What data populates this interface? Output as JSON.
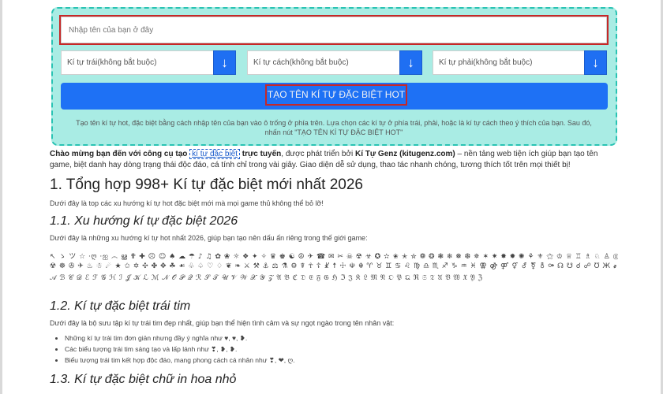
{
  "form": {
    "name_placeholder": "Nhập tên của bạn ở đây",
    "select_left": "Kí tự trái(không bắt buộc)",
    "select_middle": "Kí tự cách(không bắt buộc)",
    "select_right": "Kí tự phải(không bắt buộc)",
    "arrow_glyph": "↓",
    "generate_label": "TẠO TÊN KÍ TỰ ĐẶC BIỆT HOT",
    "hint": "Tạo tên kí tự hot, đặc biệt bằng cách nhập tên của bạn vào ô trống ở phía trên. Lựa chọn các kí tự ở phía trái, phải, hoặc là kí tự cách theo ý thích của bạn. Sau đó, nhấn nút \"TẠO TÊN KÍ TỰ ĐẶC BIỆT HOT\""
  },
  "intro": {
    "lead_bold": "Chào mừng bạn đến với công cụ tạo",
    "link": "kí tự đặc biệt",
    "bold_after_link": "trực tuyến",
    "text_1": ", được phát triển bởi",
    "brand": "Kí Tự Genz (kitugenz.com)",
    "text_2": "– nền tảng web tiện ích giúp bạn tạo tên game, biệt danh hay dòng trạng thái độc đáo, cá tính chỉ trong vài giây. Giao diện dễ sử dụng, thao tác nhanh chóng, tương thích tốt trên mọi thiết bị!"
  },
  "section1": {
    "title": "1. Tổng hợp 998+ Kí tự đặc biệt mới nhất 2026",
    "desc": "Dưới đây là top các xu hướng kí tự hot đặc biệt mới mà mọi game thủ không thể bỏ lỡ!"
  },
  "section1_1": {
    "title": "1.1. Xu hướng kí tự đặc biệt 2026",
    "desc": "Dưới đây là những xu hướng kí tự hot nhất 2026, giúp bạn tạo nên dấu ấn riêng trong thế giới game:",
    "symbols_line1": "↖ ゝ ツ ☆ ·ღ ·ஐ ෴ ൠ ✟ ✚ ☹ ☺ ♠ ☁ ☂ ♪ ♫ ✿ ❀ ☼ ❖ ✦ ✧ ♛ ♚ ☯ ☮ ✈ ☎ ✉ ✂ ☠ ☢ ☣ ✪ ✫ ✬ ✭ ✮ ❁ ❂ ❃ ❄ ❅ ❆ ✵ ✶ ✷ ✸ ✹ ✺ ⚘ ⚜ ⚝ ♔ ♕ ♖ ♗ ♘ ♙ ◎ ◉ ◈ ◇ ◆ ▣ ▤ ▥ ▦ ▧ ▨ ⊙ ⊚ ⊛ ∞ ∂ ℓ ℘",
    "symbols_line2": "☢ ☸ ✇ ✈ ♨ ☃ ☄ ★ ✩ ✡ ✣ ✤ ✥ ☘ ☙ ♧ ♤ ♡ ♢ ❦ ❧ ⚔ ⚒ ⚓ ⚖ ⚗ ⚙ ☤ ☥ ☦ ☧ ☨ ☩ ☫ ☬ ♈ ♉ ♊ ♋ ♌ ♍ ♎ ♏ ♐ ♑ ♒ ♓ ⚢ ⚣ ⚤ ⚥ ⚦ ⚧ ⚨ ⚩ ☊ ☋ ☌ ☍ Ʊ Ӂ ҂ Ԇ ԇ Ɯ Ǣ Ʀ Ȿ ɮ ʘ ʭ Æ Ɐ Ǽ",
    "symbols_line3": "𝒜 ℬ 𝒞 𝒟 ℰ ℱ 𝒢 ℋ ℐ 𝒥 𝒦 ℒ ℳ 𝒩 𝒪 𝒫 𝒬 ℛ 𝒮 𝒯 𝒰 𝒱 𝒲 𝒳 𝒴 𝒵 𝔄 𝔅 ℭ 𝔇 𝔈 𝔉 𝔊 ℌ ℑ 𝔍 𝔎 𝔏 𝔐 𝔑 𝔒 𝔓 𝔔 ℜ 𝔖 𝔗 𝔘 𝔙 𝔚 𝔛 𝔜 ℨ"
  },
  "section1_2": {
    "title": "1.2. Kí tự đặc biệt trái tim",
    "desc": "Dưới đây là bộ sưu tập kí tự trái tim đẹp nhất, giúp bạn thể hiện tình cảm và sự ngọt ngào trong tên nhân vật:",
    "bullets": [
      "Những kí tự trái tim đơn giản nhưng đầy ý nghĩa như ♥, ♥, ❥.",
      "Các biểu tượng trái tim sáng tạo và lấp lánh như ❣, ❥, ❥.",
      "Biểu tượng trái tim kết hợp độc đáo, mang phong cách cá nhân như ❣, ❤, ღ."
    ]
  },
  "section1_3": {
    "title": "1.3. Kí tự đặc biệt chữ in hoa nhỏ"
  },
  "colors": {
    "panel_bg": "#a9ece4",
    "panel_border": "#29c3b3",
    "primary": "#1e71f5",
    "highlight_red": "#c62828"
  }
}
